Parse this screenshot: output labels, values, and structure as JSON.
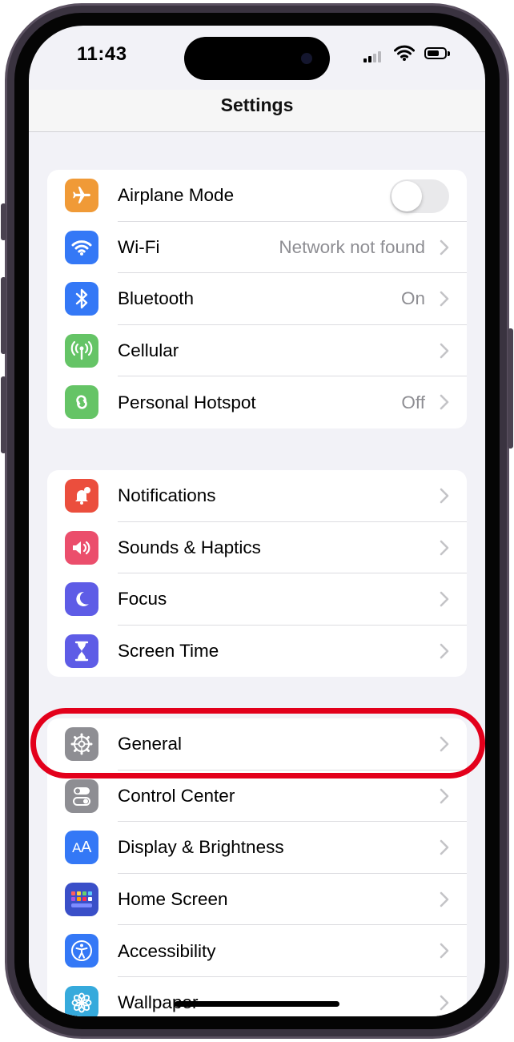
{
  "status_bar": {
    "time": "11:43"
  },
  "header": {
    "title": "Settings"
  },
  "groups": [
    {
      "items": [
        {
          "label": "Airplane Mode",
          "icon": "airplane-icon",
          "color": "#F09A37",
          "toggle": false
        },
        {
          "label": "Wi-Fi",
          "value": "Network not found",
          "icon": "wifi-icon",
          "color": "#3478F6"
        },
        {
          "label": "Bluetooth",
          "value": "On",
          "icon": "bluetooth-icon",
          "color": "#3478F6"
        },
        {
          "label": "Cellular",
          "value": "",
          "icon": "cellular-icon",
          "color": "#65C466"
        },
        {
          "label": "Personal Hotspot",
          "value": "Off",
          "icon": "hotspot-icon",
          "color": "#65C466"
        }
      ]
    },
    {
      "items": [
        {
          "label": "Notifications",
          "icon": "notifications-icon",
          "color": "#EB4E3D"
        },
        {
          "label": "Sounds & Haptics",
          "icon": "sounds-icon",
          "color": "#EB4E6C"
        },
        {
          "label": "Focus",
          "icon": "moon-icon",
          "color": "#5E5CE6"
        },
        {
          "label": "Screen Time",
          "icon": "hourglass-icon",
          "color": "#5E5CE6"
        }
      ]
    },
    {
      "items": [
        {
          "label": "General",
          "icon": "gear-icon",
          "color": "#8E8E93",
          "highlighted": true
        },
        {
          "label": "Control Center",
          "icon": "control-center-icon",
          "color": "#8E8E93"
        },
        {
          "label": "Display & Brightness",
          "icon": "display-icon",
          "color": "#3478F6"
        },
        {
          "label": "Home Screen",
          "icon": "home-screen-icon",
          "color": "#3A4FC8"
        },
        {
          "label": "Accessibility",
          "icon": "accessibility-icon",
          "color": "#3478F6"
        },
        {
          "label": "Wallpaper",
          "icon": "wallpaper-icon",
          "color": "#36AADC"
        }
      ]
    }
  ],
  "accent": {
    "highlight": "#E3001B"
  }
}
